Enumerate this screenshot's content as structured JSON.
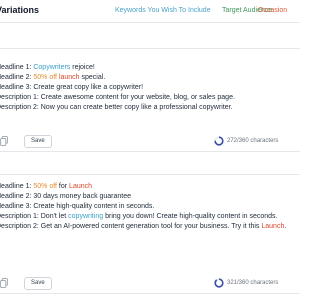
{
  "header": {
    "title": "Variations",
    "tags": {
      "keywords": "Keywords You Wish To Include",
      "audience": "Target Audience",
      "occasion": "Occasion"
    }
  },
  "colors": {
    "keywords": "#4aa3c7",
    "audience": "#3f9a5c",
    "occasion": "#e15a3a",
    "highlight_blue": "#3b9fc9",
    "highlight_orange": "#e38d2f",
    "highlight_red": "#d9462c"
  },
  "cards": [
    {
      "lines": [
        {
          "prefix": "Headline 1: ",
          "parts": [
            {
              "text": "Copywriters",
              "style": "blue"
            },
            {
              "text": " rejoice!",
              "style": ""
            }
          ]
        },
        {
          "prefix": "Headline 2: ",
          "parts": [
            {
              "text": "50% off",
              "style": "orange"
            },
            {
              "text": " ",
              "style": ""
            },
            {
              "text": "launch",
              "style": "red"
            },
            {
              "text": " special.",
              "style": ""
            }
          ]
        },
        {
          "prefix": "Headline 3: ",
          "parts": [
            {
              "text": "Create great copy like a copywriter!",
              "style": ""
            }
          ]
        },
        {
          "prefix": "Description 1: ",
          "parts": [
            {
              "text": "Create awesome content for your website, blog, or sales page.",
              "style": ""
            }
          ]
        },
        {
          "prefix": "Description 2: ",
          "parts": [
            {
              "text": "Now you can create better copy like a professional copywriter.",
              "style": ""
            }
          ]
        }
      ],
      "save_label": "Save",
      "char_count": "272/360 characters",
      "char_fraction": 0.756,
      "copy_icon": "copy-icon"
    },
    {
      "lines": [
        {
          "prefix": "Headline 1: ",
          "parts": [
            {
              "text": "50% off",
              "style": "orange"
            },
            {
              "text": " for ",
              "style": ""
            },
            {
              "text": "Launch",
              "style": "red"
            }
          ]
        },
        {
          "prefix": "Headline 2: ",
          "parts": [
            {
              "text": "30 days money back guarantee",
              "style": ""
            }
          ]
        },
        {
          "prefix": "Headline 3: ",
          "parts": [
            {
              "text": "Create high-quality content in seconds.",
              "style": ""
            }
          ]
        },
        {
          "prefix": "Description 1: ",
          "parts": [
            {
              "text": "Don't let ",
              "style": ""
            },
            {
              "text": "copywriting",
              "style": "blue"
            },
            {
              "text": " bring you down! Create high-quality content in seconds.",
              "style": ""
            }
          ]
        },
        {
          "prefix": "Description 2: ",
          "parts": [
            {
              "text": "Get an AI-powered content generation tool for your business. Try it this ",
              "style": ""
            },
            {
              "text": "Launch",
              "style": "red"
            },
            {
              "text": ".",
              "style": ""
            }
          ]
        }
      ],
      "save_label": "Save",
      "char_count": "321/360 characters",
      "char_fraction": 0.892,
      "copy_icon": "copy-icon"
    }
  ]
}
